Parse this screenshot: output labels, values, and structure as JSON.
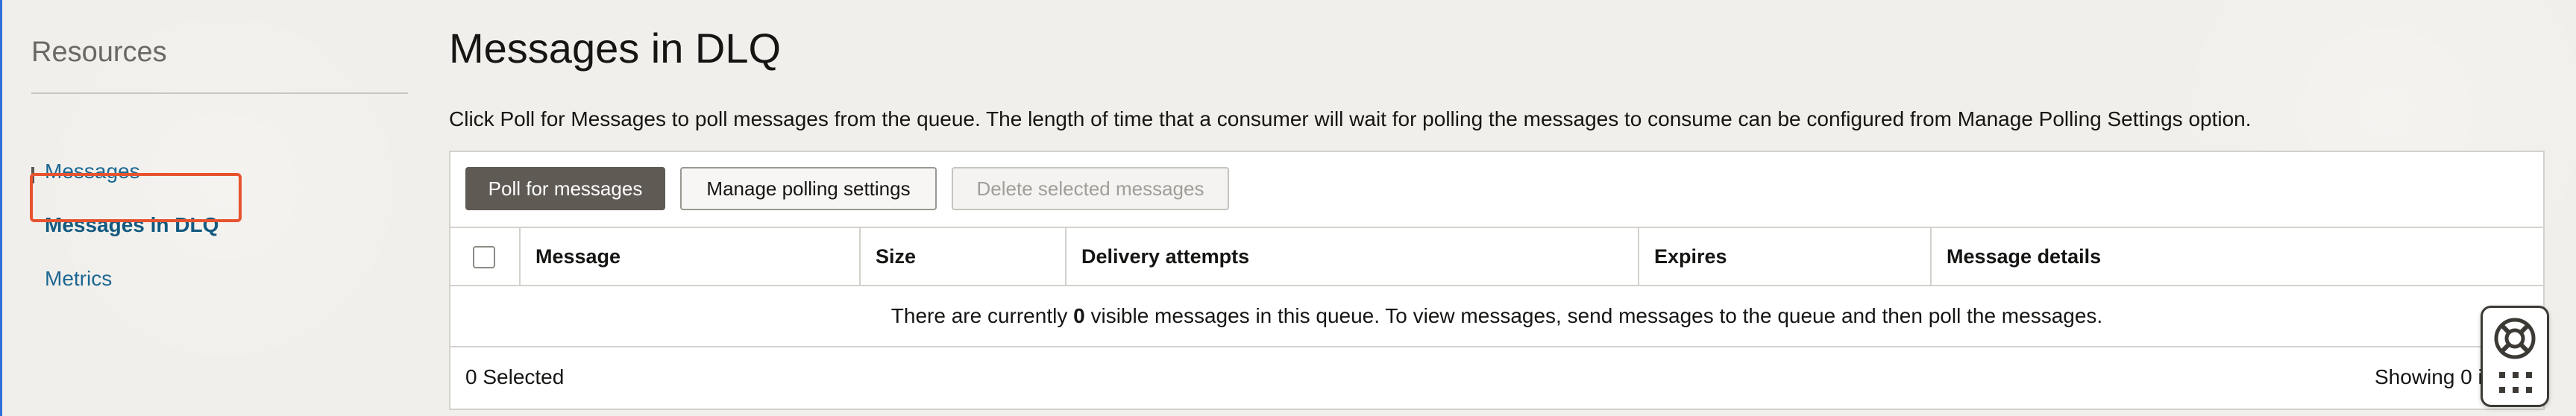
{
  "sidebar": {
    "title": "Resources",
    "items": [
      {
        "label": "Messages",
        "active": false
      },
      {
        "label": "Messages in DLQ",
        "active": true
      },
      {
        "label": "Metrics",
        "active": false
      }
    ]
  },
  "main": {
    "title": "Messages in DLQ",
    "description": "Click Poll for Messages to poll messages from the queue. The length of time that a consumer will wait for polling the messages to consume can be configured from Manage Polling Settings option.",
    "toolbar": {
      "poll_label": "Poll for messages",
      "manage_label": "Manage polling settings",
      "delete_label": "Delete selected messages"
    },
    "table": {
      "columns": [
        "Message",
        "Size",
        "Delivery attempts",
        "Expires",
        "Message details"
      ],
      "empty_prefix": "There are currently ",
      "empty_count": "0",
      "empty_suffix": " visible messages in this queue. To view messages, send messages to the queue and then poll the messages.",
      "selected_text": "0 Selected",
      "showing_text": "Showing 0 items"
    }
  },
  "colors": {
    "link": "#1d6893",
    "highlight": "#e8532f",
    "primary_button": "#5f5a54"
  },
  "icons": {
    "help": "lifebuoy-icon",
    "apps": "apps-grid-icon"
  }
}
